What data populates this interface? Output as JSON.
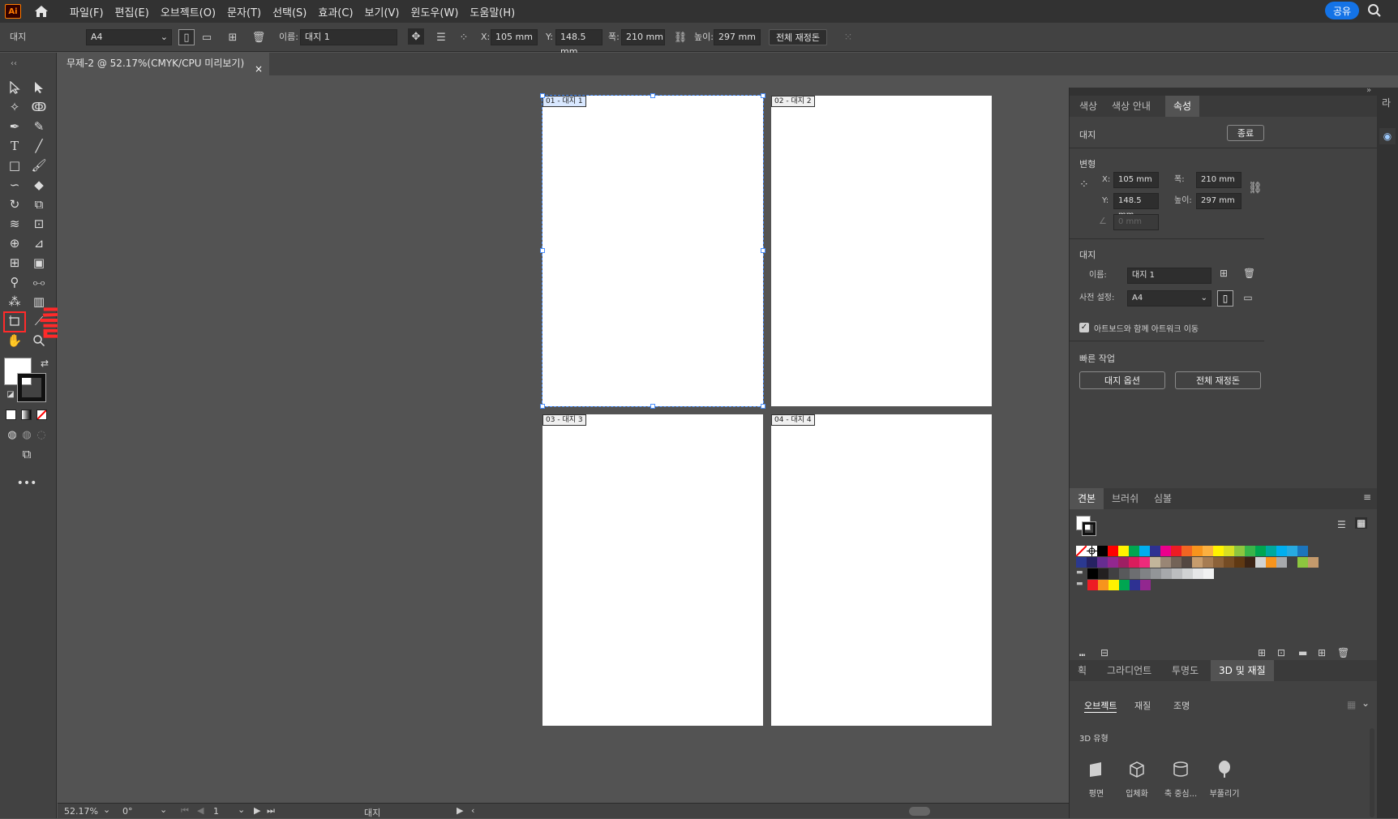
{
  "app": {
    "logo": "Ai"
  },
  "menu": [
    "파일(F)",
    "편집(E)",
    "오브젝트(O)",
    "문자(T)",
    "선택(S)",
    "효과(C)",
    "보기(V)",
    "윈도우(W)",
    "도움말(H)"
  ],
  "share_label": "공유",
  "controlbar": {
    "mode": "대지",
    "preset": "A4",
    "name_label": "이름:",
    "name_value": "대지 1",
    "x_label": "X:",
    "x_value": "105 mm",
    "y_label": "Y:",
    "y_value": "148.5 mm",
    "w_label": "폭:",
    "w_value": "210 mm",
    "h_label": "높이:",
    "h_value": "297 mm",
    "rearrange_label": "전체 재정돈"
  },
  "document_tab": {
    "title": "무제-2 @ 52.17%(CMYK/CPU 미리보기)",
    "close": "×"
  },
  "annotation": {
    "text": "클릭",
    "color": "#ff2a2a"
  },
  "artboards": [
    {
      "label": "01 - 대지 1",
      "selected": true
    },
    {
      "label": "02 - 대지 2",
      "selected": false
    },
    {
      "label": "03 - 대지 3",
      "selected": false
    },
    {
      "label": "04 - 대지 4",
      "selected": false
    }
  ],
  "statusbar": {
    "zoom": "52.17%",
    "rotation": "0°",
    "page": "1",
    "mode": "대지"
  },
  "properties_panel": {
    "tabs": [
      "색상",
      "색상 안내",
      "속성"
    ],
    "active_tab": "속성",
    "artboard_header": "대지",
    "exit_label": "종료",
    "transform_title": "변형",
    "x_label": "X:",
    "x_value": "105 mm",
    "y_label": "Y:",
    "y_value": "148.5 mm",
    "w_label": "폭:",
    "w_value": "210 mm",
    "h_label": "높이:",
    "h_value": "297 mm",
    "angle_value": "0 mm",
    "artboard_title": "대지",
    "name_label": "이름:",
    "name_value": "대지 1",
    "preset_label": "사전 설정:",
    "preset_value": "A4",
    "move_artwork_label": "아트보드와 함께 아트워크 이동",
    "move_artwork_checked": true,
    "quick_title": "빠른 작업",
    "artboard_options_label": "대지 옵션",
    "rearrange_label": "전체 재정돈"
  },
  "swatches_panel": {
    "tabs": [
      "견본",
      "브러쉬",
      "심볼"
    ],
    "active_tab": "견본",
    "row1": [
      "#ffffff",
      "#ffffff",
      "#000000",
      "#ff0000",
      "#fff200",
      "#00a650",
      "#00aeef",
      "#2e3192",
      "#ec008c",
      "#ed1c24",
      "#f26522",
      "#f7941d",
      "#fbb040",
      "#fff200",
      "#d7df23",
      "#8dc63f",
      "#39b54a",
      "#00a651",
      "#00a99d",
      "#00aeef",
      "#27aae1",
      "#1c75bc"
    ],
    "row2": [
      "#2b3990",
      "#262262",
      "#662d91",
      "#92278f",
      "#9e1f63",
      "#da1c5c",
      "#ee2a7b",
      "#c2b59b",
      "#998675",
      "#736357",
      "#534741",
      "#c69c6d",
      "#a67c52",
      "#8c6239",
      "#754c24",
      "#603913",
      "#3c2415",
      "#d1d3d4",
      "#f7941d",
      "#a7a9ac",
      "#414042",
      "#8dc63f",
      "#c49a6c"
    ],
    "row3": [
      "#000000",
      "#231f20",
      "#414042",
      "#58595b",
      "#6d6e71",
      "#808285",
      "#939598",
      "#a7a9ac",
      "#bcbec0",
      "#d1d3d4",
      "#e6e7e8",
      "#f1f2f2"
    ],
    "row4": [
      "#ed1c24",
      "#f7941d",
      "#fff200",
      "#00a651",
      "#2e3192",
      "#92278f"
    ]
  },
  "bottom_panel": {
    "tabs": [
      "획",
      "그라디언트",
      "투명도",
      "3D 및 재질"
    ],
    "active_tab": "3D 및 재질",
    "subtabs": [
      "오브젝트",
      "재질",
      "조명"
    ],
    "active_subtab": "오브젝트",
    "type_title": "3D 유형",
    "types": [
      "평면",
      "입체화",
      "축 중심...",
      "부풀리기"
    ]
  },
  "right_strip": {
    "label": "라"
  }
}
